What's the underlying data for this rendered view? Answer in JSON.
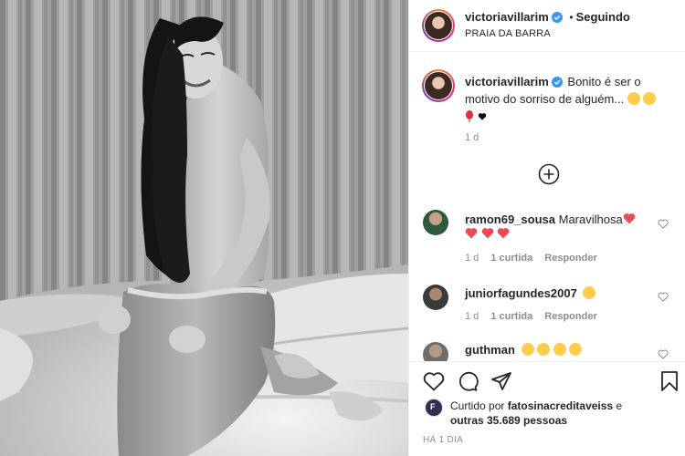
{
  "post": {
    "username": "victoriavillarim",
    "follow_dot": "•",
    "follow_status": "Seguindo",
    "location": "PRAIA DA BARRA"
  },
  "caption": {
    "username": "victoriavillarim",
    "text": "Bonito é ser o motivo do sorriso de alguém...",
    "emojis": [
      "grinning-face",
      "heart-eyes-face",
      "balloon",
      "black-heart"
    ],
    "age": "1 d"
  },
  "load_more_icon": "plus-circle-icon",
  "comments": [
    {
      "username": "ramon69_sousa",
      "text": "Maravilhosa",
      "emojis": [
        "heart",
        "heart",
        "heart",
        "heart"
      ],
      "age": "1 d",
      "likes": "1 curtida",
      "reply": "Responder"
    },
    {
      "username": "juniorfagundes2007",
      "text": "",
      "emojis": [
        "kissing-face"
      ],
      "age": "1 d",
      "likes": "1 curtida",
      "reply": "Responder"
    },
    {
      "username": "guthman",
      "text": "",
      "emojis": [
        "kissing-face",
        "kissing-face",
        "kissing-face",
        "kissing-face"
      ],
      "age": "",
      "likes": "",
      "reply": ""
    }
  ],
  "actions": {
    "like_icon": "heart-outline-icon",
    "comment_icon": "comment-icon",
    "share_icon": "paper-plane-icon",
    "save_icon": "bookmark-icon"
  },
  "likes": {
    "prefix": "Curtido por",
    "user": "fatosinacreditaveiss",
    "and": "e",
    "others": "outras 35.689 pessoas"
  },
  "timestamp": "HÁ 1 DIA",
  "colors": {
    "verified": "#3897f0",
    "heart": "#ed4956",
    "muted": "#8e8e8e",
    "text": "#262626"
  }
}
